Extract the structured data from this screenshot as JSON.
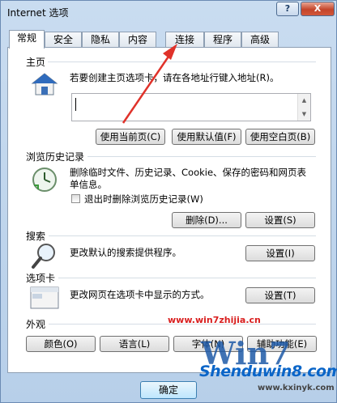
{
  "window": {
    "title": "Internet 选项",
    "help_label": "?",
    "close_label": "X"
  },
  "tabs": [
    {
      "label": "常规"
    },
    {
      "label": "安全"
    },
    {
      "label": "隐私"
    },
    {
      "label": "内容"
    },
    {
      "label": "连接"
    },
    {
      "label": "程序"
    },
    {
      "label": "高级"
    }
  ],
  "homepage": {
    "title": "主页",
    "description": "若要创建主页选项卡，请在各地址行键入地址(R)。",
    "value": "",
    "buttons": {
      "current": "使用当前页(C)",
      "default": "使用默认值(F)",
      "blank": "使用空白页(B)"
    }
  },
  "history": {
    "title": "浏览历史记录",
    "description": "删除临时文件、历史记录、Cookie、保存的密码和网页表单信息。",
    "checkbox_label": "退出时删除浏览历史记录(W)",
    "checked": false,
    "buttons": {
      "delete": "删除(D)...",
      "settings": "设置(S)"
    }
  },
  "search": {
    "title": "搜索",
    "description": "更改默认的搜索提供程序。",
    "settings": "设置(I)"
  },
  "tabs_section": {
    "title": "选项卡",
    "description": "更改网页在选项卡中显示的方式。",
    "settings": "设置(T)"
  },
  "appearance": {
    "title": "外观",
    "buttons": {
      "colors": "颜色(O)",
      "languages": "语言(L)",
      "fonts": "字体(N)",
      "accessibility": "辅助功能(E)"
    }
  },
  "footer": {
    "ok": "确定"
  },
  "watermark": {
    "url": "www.win7zhijia.cn",
    "brand": "Shenduwin8.com",
    "sub": "www.kxinyk.com",
    "win7": "Win7"
  }
}
